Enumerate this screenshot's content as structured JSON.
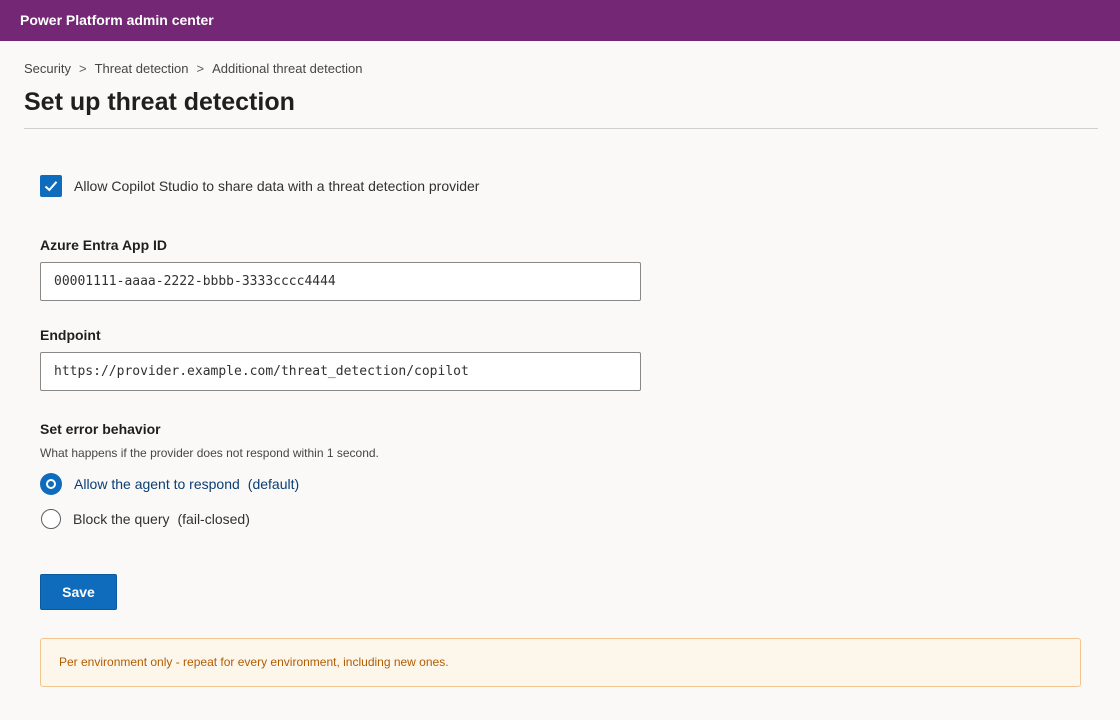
{
  "app": {
    "title": "Power Platform admin center"
  },
  "breadcrumb": {
    "items": [
      "Security",
      "Threat detection",
      "Additional threat detection"
    ],
    "separator": ">"
  },
  "page": {
    "title": "Set up threat detection"
  },
  "consent": {
    "label": "Allow Copilot Studio to share data with a threat detection provider",
    "checked": true
  },
  "fields": {
    "app_id": {
      "label": "Azure Entra App ID",
      "value": "00001111-aaaa-2222-bbbb-3333cccc4444"
    },
    "endpoint": {
      "label": "Endpoint",
      "value": "https://provider.example.com/threat_detection/copilot"
    }
  },
  "error_behavior": {
    "title": "Set error behavior",
    "helper": "What happens if the provider does not respond within 1 second.",
    "options": [
      {
        "label": "Allow the agent to respond",
        "suffix": "(default)",
        "selected": true
      },
      {
        "label": "Block the query",
        "suffix": "(fail-closed)",
        "selected": false
      }
    ]
  },
  "actions": {
    "save_label": "Save"
  },
  "notice": {
    "text": "Per environment only - repeat for every environment, including new ones."
  },
  "colors": {
    "header": "#742774",
    "accent": "#0f6cbd",
    "notice_bg": "#fdf6eb",
    "notice_text": "#b35c00"
  },
  "icons": {
    "checkbox": "checkmark-icon",
    "radio_selected": "radio-selected-icon",
    "radio_unselected": "radio-empty-icon"
  }
}
